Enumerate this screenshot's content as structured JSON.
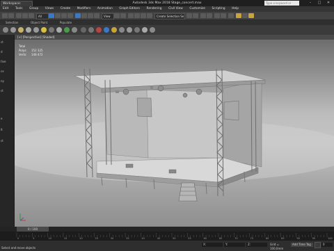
{
  "titlebar": {
    "workspace": "Workspace: Default",
    "title": "Autodesk 3ds Max 2018    Stage_concert.max",
    "search_placeholder": "Type a keyword or phrase",
    "minimize": "–",
    "maximize": "□",
    "close": "✕"
  },
  "menu": {
    "items": [
      "Edit",
      "Tools",
      "Group",
      "Views",
      "Create",
      "Modifiers",
      "Animation",
      "Graph Editors",
      "Rendering",
      "Civil View",
      "Customize",
      "Scripting",
      "Help"
    ]
  },
  "toolbar": {
    "selection_filter": "All",
    "view_dropdown": "View",
    "selection_set": "Create Selection Se"
  },
  "ribbon": {
    "tabs": [
      "Selection",
      "Object Paint",
      "Populate"
    ]
  },
  "viewport": {
    "label": "[+] [Perspective] [Shaded]",
    "stats": {
      "total_label": "Total",
      "polys_label": "Polys:",
      "polys_value": "152 325",
      "verts_label": "Verts:",
      "verts_value": "148 472"
    }
  },
  "left_panel": {
    "labels": [
      "ct",
      "d",
      "tive",
      "ce",
      "ny",
      "ct",
      "e",
      "lt",
      "ct"
    ]
  },
  "timeline": {
    "thumb_label": "0 / 100",
    "ticks": [
      "0",
      "5",
      "10",
      "15",
      "20",
      "25",
      "30",
      "35",
      "40",
      "45",
      "50",
      "55",
      "60",
      "65",
      "70",
      "75",
      "80",
      "85",
      "90",
      "95",
      "100"
    ]
  },
  "status": {
    "message": "Select and move objects",
    "x_label": "X:",
    "y_label": "Y:",
    "z_label": "Z:",
    "grid": "Grid = 100,0mm",
    "add_time_tag": "Add Time Tag",
    "frame": "0"
  },
  "colors": {
    "accent": "#3a78c8",
    "viewport_bg": "#bdbdbd"
  }
}
